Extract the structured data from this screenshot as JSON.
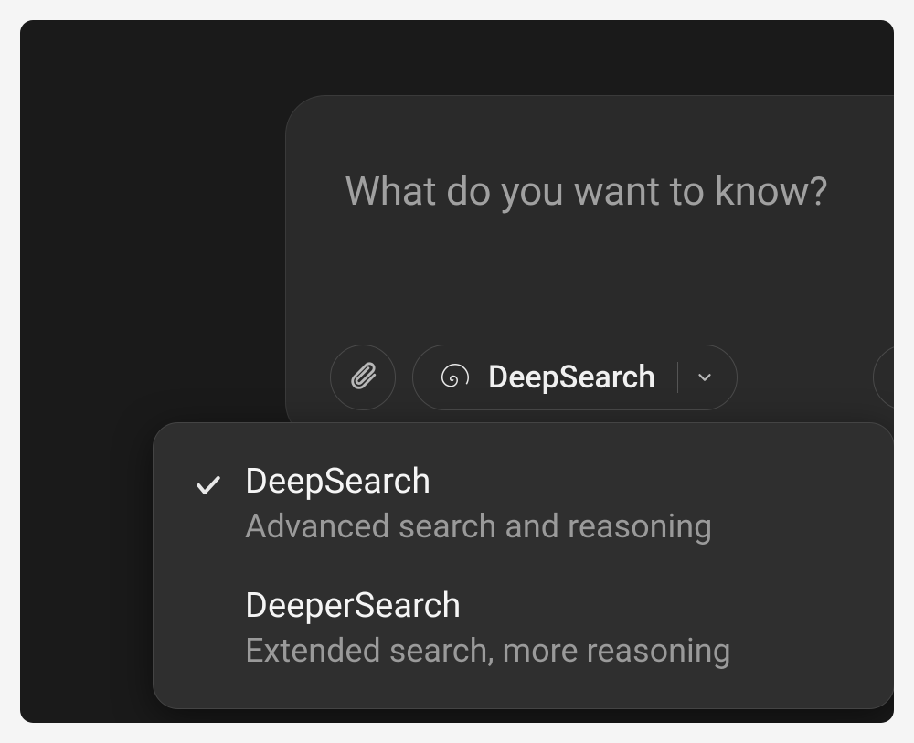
{
  "input": {
    "placeholder": "What do you want to know?"
  },
  "toolbar": {
    "mode_label": "DeepSearch"
  },
  "dropdown": {
    "items": [
      {
        "title": "DeepSearch",
        "description": "Advanced search and reasoning",
        "selected": true
      },
      {
        "title": "DeeperSearch",
        "description": "Extended search, more reasoning",
        "selected": false
      }
    ]
  }
}
